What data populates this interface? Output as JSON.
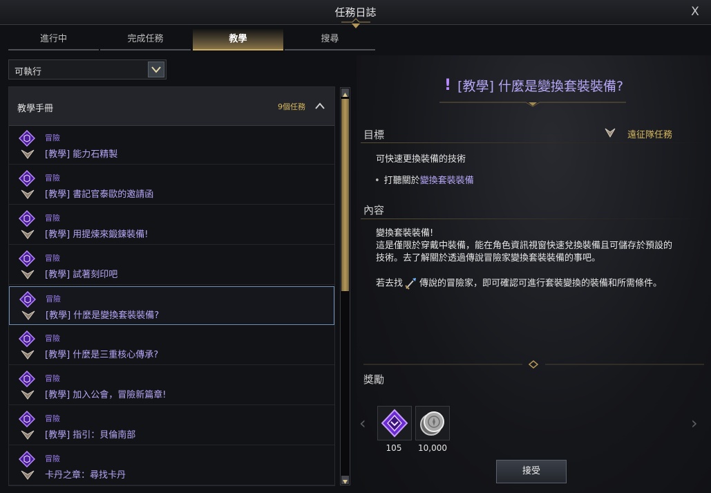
{
  "window": {
    "title": "任務日誌",
    "close_label": "X"
  },
  "tabs": [
    {
      "label": "進行中",
      "active": false
    },
    {
      "label": "完成任務",
      "active": false
    },
    {
      "label": "教學",
      "active": true
    },
    {
      "label": "搜尋",
      "active": false
    }
  ],
  "filter": {
    "selected": "可執行"
  },
  "list": {
    "header_title": "教學手冊",
    "header_count": "9個任務",
    "items": [
      {
        "category": "冒險",
        "name": "[教學] 能力石精製",
        "selected": false
      },
      {
        "category": "冒險",
        "name": "[教學] 書記官泰歐的邀請函",
        "selected": false
      },
      {
        "category": "冒險",
        "name": "[教學] 用提煉來鍛鍊裝備!",
        "selected": false
      },
      {
        "category": "冒險",
        "name": "[教學] 試著刻印吧",
        "selected": false
      },
      {
        "category": "冒險",
        "name": "[教學] 什麼是變換套裝裝備?",
        "selected": true
      },
      {
        "category": "冒險",
        "name": "[教學] 什麼是三重核心傳承?",
        "selected": false
      },
      {
        "category": "冒險",
        "name": "[教學] 加入公會，冒險新篇章!",
        "selected": false
      },
      {
        "category": "冒險",
        "name": "[教學] 指引：貝倫南部",
        "selected": false
      },
      {
        "category": "冒險",
        "name": "卡丹之章：尋找卡丹",
        "selected": false
      }
    ]
  },
  "detail": {
    "title": "[教學] 什麼是變換套裝裝備?",
    "objective_head": "目標",
    "expedition_label": "遠征隊任務",
    "objective_desc": "可快速更換裝備的技術",
    "objective_prefix": "打聽關於",
    "objective_link": "變換套裝裝備",
    "content_head": "內容",
    "content_line1": "變換套裝裝備!",
    "content_line2": "這是僅限於穿戴中裝備，能在角色資訊視窗快速兌換裝備且可儲存於預設的技術。去了解關於透過傳說冒險家變換套裝裝備的事吧。",
    "content_p2_before": "若去找",
    "content_p2_after": "傳說的冒險家，即可確認可進行套裝變換的裝備和所需條件。",
    "reward_head": "獎勵",
    "rewards": [
      {
        "icon": "purple-crystal-icon",
        "value": "105"
      },
      {
        "icon": "silver-coin-icon",
        "value": "10,000"
      }
    ],
    "accept_label": "接受"
  },
  "colors": {
    "accent_gold": "#d7b85e",
    "quest_purple": "#b6a7f6",
    "selected_border": "#6f8fb4"
  }
}
